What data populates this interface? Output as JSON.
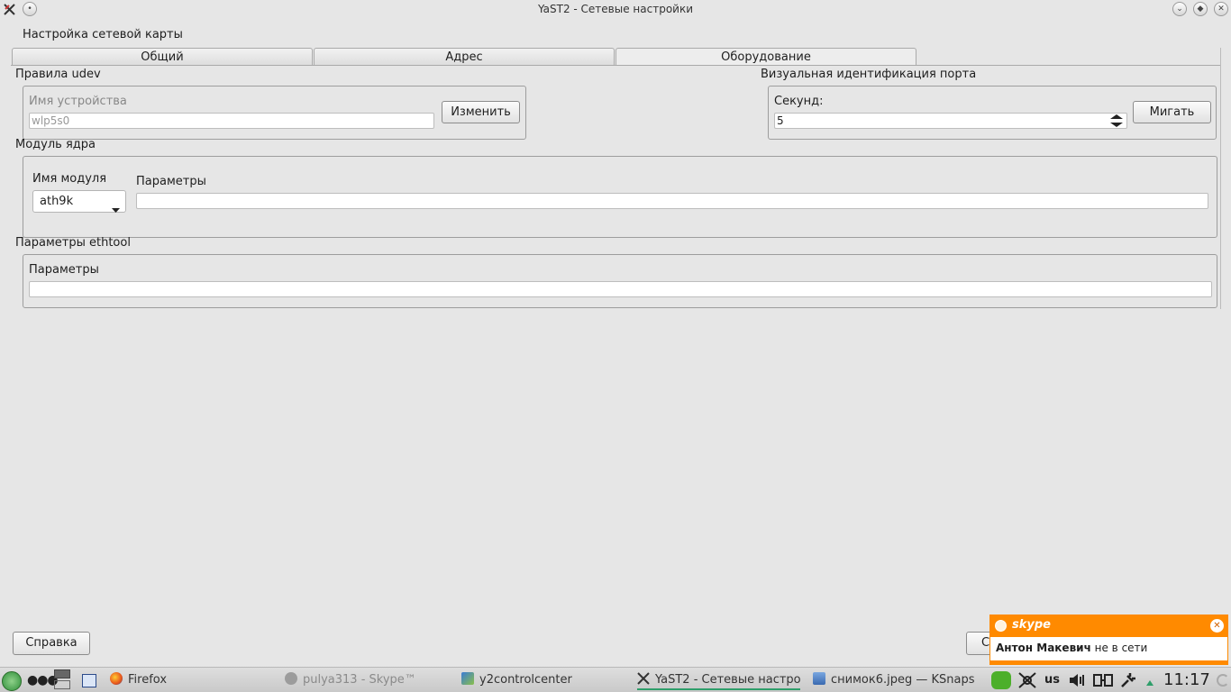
{
  "window": {
    "title": "YaST2 - Сетевые настройки"
  },
  "header": {
    "label": "Настройка сетевой карты"
  },
  "tabs": [
    {
      "label": "Общий"
    },
    {
      "label": "Адрес"
    },
    {
      "label": "Оборудование"
    }
  ],
  "udev": {
    "title": "Правила udev",
    "device_label": "Имя устройства",
    "device_value": "wlp5s0",
    "change_button": "Изменить"
  },
  "port_id": {
    "title": "Визуальная идентификация порта",
    "seconds_label": "Секунд:",
    "seconds_value": "5",
    "blink_button": "Мигать"
  },
  "kernel": {
    "title": "Модуль ядра",
    "module_label": "Имя модуля",
    "module_value": "ath9k",
    "params_label": "Параметры",
    "params_value": ""
  },
  "ethtool": {
    "title": "Параметры ethtool",
    "params_label": "Параметры",
    "params_value": ""
  },
  "footer": {
    "help_button": "Справка",
    "ok_button_partial": "С"
  },
  "skype": {
    "logo": "skype",
    "contact": "Антон Макевич",
    "status": "не в сети"
  },
  "taskbar": {
    "items": [
      {
        "label": "Firefox"
      },
      {
        "label": "pulya313 - Skype™"
      },
      {
        "label": "y2controlcenter"
      },
      {
        "label": "YaST2 - Сетевые настро"
      },
      {
        "label": "снимок6.jpeg — KSnapsh"
      }
    ],
    "keyboard": "us",
    "clock": "11:17"
  },
  "colors": {
    "accent": "#ff8a00",
    "taskbar_active": "#2e9e6a",
    "tray_green": "#4caf2a"
  }
}
